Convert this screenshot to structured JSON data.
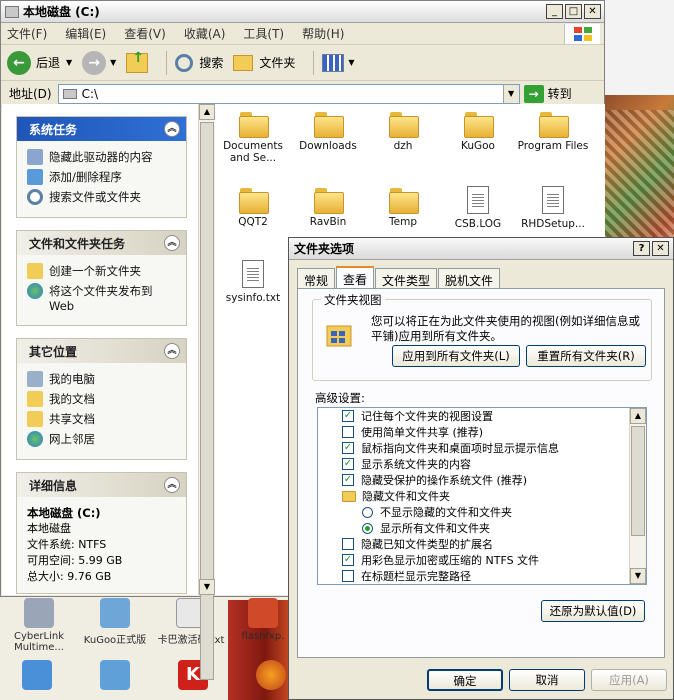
{
  "explorer": {
    "title": "本地磁盘 (C:)",
    "menu": [
      "文件(F)",
      "编辑(E)",
      "查看(V)",
      "收藏(A)",
      "工具(T)",
      "帮助(H)"
    ],
    "toolbar": {
      "back": "后退",
      "search": "搜索",
      "folders": "文件夹"
    },
    "address": {
      "label": "地址(D)",
      "value": "C:\\",
      "go": "转到"
    },
    "panels": {
      "system_tasks": {
        "title": "系统任务",
        "items": [
          "隐藏此驱动器的内容",
          "添加/删除程序",
          "搜索文件或文件夹"
        ]
      },
      "file_tasks": {
        "title": "文件和文件夹任务",
        "items": [
          "创建一个新文件夹",
          "将这个文件夹发布到 Web"
        ]
      },
      "other_places": {
        "title": "其它位置",
        "items": [
          "我的电脑",
          "我的文档",
          "共享文档",
          "网上邻居"
        ]
      },
      "details": {
        "title": "详细信息",
        "name": "本地磁盘 (C:)",
        "type": "本地磁盘",
        "filesystem": "文件系统: NTFS",
        "free": "可用空间: 5.99 GB",
        "total": "总大小: 9.76 GB"
      }
    },
    "files": [
      {
        "name": "Documents and Se...",
        "kind": "folder"
      },
      {
        "name": "Downloads",
        "kind": "folder"
      },
      {
        "name": "dzh",
        "kind": "folder"
      },
      {
        "name": "KuGoo",
        "kind": "folder"
      },
      {
        "name": "Program Files",
        "kind": "folder"
      },
      {
        "name": "QQT2",
        "kind": "folder"
      },
      {
        "name": "RavBin",
        "kind": "folder"
      },
      {
        "name": "Temp",
        "kind": "folder"
      },
      {
        "name": "CSB.LOG",
        "kind": "doc"
      },
      {
        "name": "RHDSetup...",
        "kind": "doc"
      },
      {
        "name": "sysinfo.txt",
        "kind": "doc"
      }
    ]
  },
  "desktop_icons": [
    "CyberLink Multime...",
    "KuGoo正式版",
    "卡巴激活码.txt",
    "flashfxp."
  ],
  "dialog": {
    "title": "文件夹选项",
    "tabs": [
      "常规",
      "查看",
      "文件类型",
      "脱机文件"
    ],
    "active_tab": "查看",
    "folder_view": {
      "legend": "文件夹视图",
      "text": "您可以将正在为此文件夹使用的视图(例如详细信息或平铺)应用到所有文件夹。",
      "apply_all": "应用到所有文件夹(L)",
      "reset_all": "重置所有文件夹(R)"
    },
    "advanced_label": "高级设置:",
    "advanced": [
      {
        "type": "check",
        "checked": true,
        "label": "记住每个文件夹的视图设置"
      },
      {
        "type": "check",
        "checked": false,
        "label": "使用简单文件共享 (推荐)"
      },
      {
        "type": "check",
        "checked": true,
        "label": "鼠标指向文件夹和桌面项时显示提示信息"
      },
      {
        "type": "check",
        "checked": true,
        "label": "显示系统文件夹的内容"
      },
      {
        "type": "check",
        "checked": true,
        "label": "隐藏受保护的操作系统文件 (推荐)"
      },
      {
        "type": "folder",
        "label": "隐藏文件和文件夹"
      },
      {
        "type": "radio",
        "checked": false,
        "label": "不显示隐藏的文件和文件夹"
      },
      {
        "type": "radio",
        "checked": true,
        "label": "显示所有文件和文件夹"
      },
      {
        "type": "check",
        "checked": false,
        "label": "隐藏已知文件类型的扩展名"
      },
      {
        "type": "check",
        "checked": true,
        "label": "用彩色显示加密或压缩的 NTFS 文件"
      },
      {
        "type": "check",
        "checked": false,
        "label": "在标题栏显示完整路径"
      }
    ],
    "restore_defaults": "还原为默认值(D)",
    "ok": "确定",
    "cancel": "取消",
    "apply": "应用(A)"
  }
}
